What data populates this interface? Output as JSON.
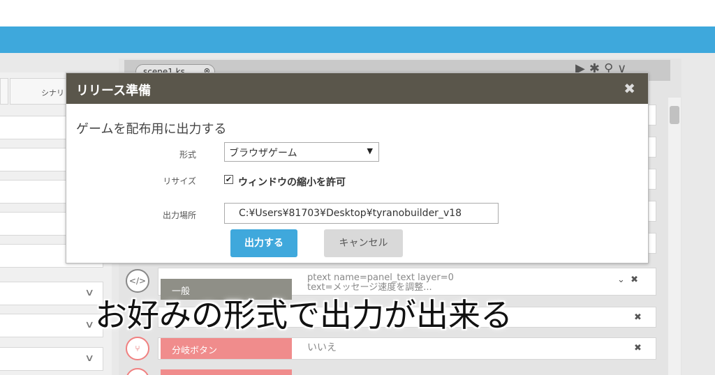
{
  "left_panel": {
    "tab_label": "シナリ"
  },
  "editor": {
    "scene_tab": "scene1.ks",
    "scene_tab_close": "⊗",
    "rows": [
      {
        "type_label": "一般",
        "text_line1": "ptext name=panel_text layer=0",
        "text_line2": "text=メッセージ速度を調整..."
      },
      {
        "type_label": "分岐ボタン",
        "text_line1": "いいえ"
      }
    ]
  },
  "dialog": {
    "title": "リリース準備",
    "close": "✖",
    "heading": "ゲームを配布用に出力する",
    "format_label": "形式",
    "format_value": "ブラウザゲーム",
    "resize_label": "リサイズ",
    "resize_option": "ウィンドウの縮小を許可",
    "resize_checked": true,
    "output_label": "出力場所",
    "output_path": "C:¥Users¥81703¥Desktop¥tyranobuilder_v18",
    "primary_button": "出力する",
    "cancel_button": "キャンセル"
  },
  "caption": "お好みの形式で出力が出来る",
  "colors": {
    "accent_blue": "#3ea8dc",
    "dialog_titlebar": "#5a564b",
    "general_label": "#8f8f87",
    "branch_label": "#f08c8c"
  }
}
